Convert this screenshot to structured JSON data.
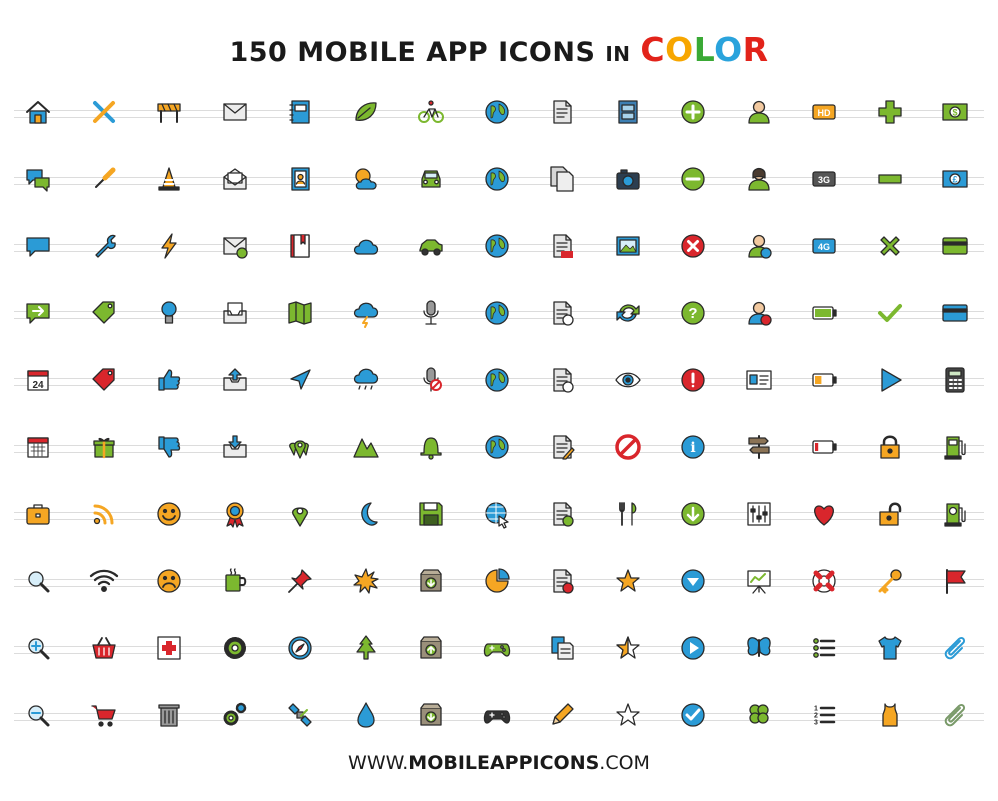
{
  "header": {
    "title_prefix": "150 MOBILE APP ICONS",
    "title_in": "IN",
    "title_color_word": "COLOR",
    "color_letters": [
      {
        "ch": "C",
        "color": "#e2231a"
      },
      {
        "ch": "O",
        "color": "#f7a600"
      },
      {
        "ch": "L",
        "color": "#3aa935"
      },
      {
        "ch": "O",
        "color": "#2aa3dc"
      },
      {
        "ch": "R",
        "color": "#e2231a"
      }
    ]
  },
  "footer": {
    "prefix": "WWW.",
    "bold": "MOBILEAPPICONS",
    "suffix": ".COM"
  },
  "colors": {
    "blue": "#2b9bd6",
    "green": "#7cb82f",
    "orange": "#f5a623",
    "red": "#d9262c",
    "dark": "#2a2a2a",
    "gray": "#bdbdbd"
  },
  "icons": [
    [
      "home-icon",
      "tools-icon",
      "roadblock-icon",
      "mail-icon",
      "notebook-icon",
      "leaf-icon",
      "bicycle-icon",
      "globe-americas-icon",
      "document-icon",
      "film-icon",
      "plus-circle-icon",
      "user-icon",
      "hd-badge-icon",
      "plus-icon",
      "dollar-bill-icon"
    ],
    [
      "chat-bubbles-icon",
      "screwdriver-icon",
      "traffic-cone-icon",
      "mail-open-icon",
      "address-book-icon",
      "sun-cloud-icon",
      "car-front-icon",
      "globe-africa-icon",
      "documents-icon",
      "camera-icon",
      "minus-circle-icon",
      "user-female-icon",
      "3g-badge-icon",
      "minus-icon",
      "pound-bill-icon"
    ],
    [
      "speech-bubble-icon",
      "wrench-icon",
      "lightning-icon",
      "mail-forward-icon",
      "book-icon",
      "cloud-icon",
      "car-side-icon",
      "globe-america-icon",
      "pdf-document-icon",
      "picture-icon",
      "close-circle-icon",
      "add-user-icon",
      "4g-badge-icon",
      "close-icon",
      "credit-card-icon"
    ],
    [
      "reply-bubble-icon",
      "tag-icon",
      "light-bulb-icon",
      "inbox-icon",
      "map-icon",
      "storm-cloud-icon",
      "microphone-icon",
      "globe-south-america-icon",
      "download-document-icon",
      "refresh-icon",
      "help-circle-icon",
      "remove-user-icon",
      "battery-full-icon",
      "checkmark-icon",
      "credit-card-blue-icon"
    ],
    [
      "calendar-date-icon",
      "price-tag-icon",
      "thumbs-up-icon",
      "outbox-icon",
      "navigation-arrow-icon",
      "rain-cloud-icon",
      "mute-microphone-icon",
      "globe-europe-icon",
      "upload-document-icon",
      "eye-icon",
      "alert-circle-icon",
      "id-card-icon",
      "battery-half-icon",
      "play-triangle-icon",
      "calculator-icon"
    ],
    [
      "calendar-icon",
      "gift-icon",
      "thumbs-down-icon",
      "inbox-download-icon",
      "location-pins-icon",
      "mountains-icon",
      "bell-icon",
      "globe-australia-icon",
      "edit-document-icon",
      "forbidden-icon",
      "info-circle-icon",
      "signpost-icon",
      "battery-low-icon",
      "lock-icon",
      "gas-pump-icon"
    ],
    [
      "briefcase-icon",
      "rss-icon",
      "smiley-icon",
      "award-badge-icon",
      "location-pin-icon",
      "moon-icon",
      "floppy-disk-icon",
      "web-cursor-icon",
      "add-document-icon",
      "fork-knife-icon",
      "down-arrow-circle-icon",
      "equalizer-icon",
      "heart-icon",
      "unlock-icon",
      "fuel-station-icon"
    ],
    [
      "magnifier-icon",
      "wifi-icon",
      "sad-face-icon",
      "coffee-mug-icon",
      "push-pin-icon",
      "sunburst-icon",
      "archive-box-icon",
      "pie-chart-icon",
      "delete-document-icon",
      "star-icon",
      "down-circle-icon",
      "presentation-icon",
      "lifebuoy-icon",
      "key-icon",
      "flag-icon"
    ],
    [
      "zoom-in-icon",
      "shopping-basket-icon",
      "first-aid-icon",
      "gear-icon",
      "compass-icon",
      "pine-tree-icon",
      "box-upload-icon",
      "game-controller-icon",
      "clipboard-icon",
      "star-half-icon",
      "play-circle-icon",
      "butterfly-icon",
      "list-icon",
      "tshirt-icon",
      "paperclip-icon"
    ],
    [
      "zoom-out-icon",
      "shopping-cart-icon",
      "trash-icon",
      "gears-icon",
      "satellite-icon",
      "water-drop-icon",
      "box-download-icon",
      "gamepad-icon",
      "pencil-icon",
      "star-outline-icon",
      "check-circle-icon",
      "clover-icon",
      "numbered-list-icon",
      "tank-top-icon",
      "paperclip-gray-icon"
    ]
  ]
}
